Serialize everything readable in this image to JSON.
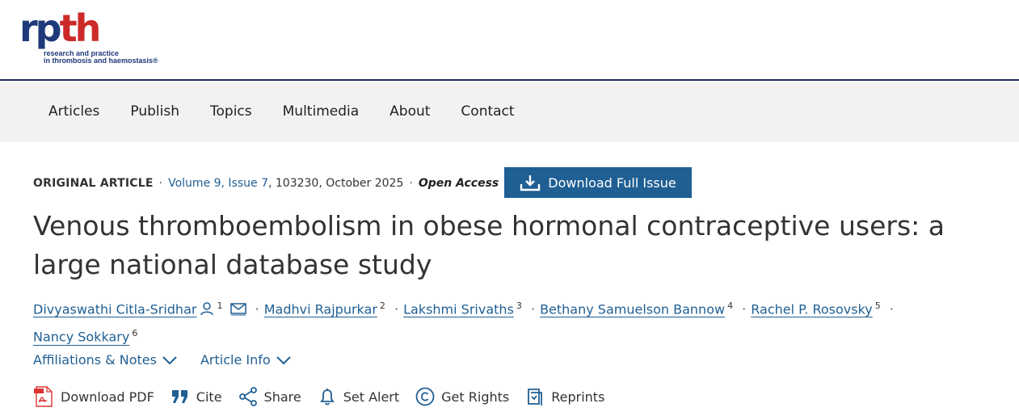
{
  "logo": {
    "mark_rp": "rp",
    "mark_th": "th",
    "tagline_1": "research and practice",
    "tagline_2": "in thrombosis and haemostasis®"
  },
  "nav": {
    "items": [
      "Articles",
      "Publish",
      "Topics",
      "Multimedia",
      "About",
      "Contact"
    ]
  },
  "meta": {
    "article_type": "ORIGINAL ARTICLE",
    "volume": "Volume 9, Issue 7",
    "details": ", 103230, October 2025",
    "access": "Open Access"
  },
  "download_issue_label": "Download Full Issue",
  "title": "Venous thromboembolism in obese hormonal contraceptive users: a large national database study",
  "authors": [
    {
      "name": "Divyaswathi Citla-Sridhar",
      "sup": "1"
    },
    {
      "name": "Madhvi Rajpurkar",
      "sup": "2"
    },
    {
      "name": "Lakshmi Srivaths",
      "sup": "3"
    },
    {
      "name": "Bethany Samuelson Bannow",
      "sup": "4"
    },
    {
      "name": "Rachel P. Rosovsky",
      "sup": "5"
    },
    {
      "name": "Nancy Sokkary",
      "sup": "6"
    }
  ],
  "toggles": {
    "affiliations": "Affiliations & Notes",
    "article_info": "Article Info"
  },
  "actions": {
    "download_pdf": "Download PDF",
    "cite": "Cite",
    "share": "Share",
    "set_alert": "Set Alert",
    "get_rights": "Get Rights",
    "reprints": "Reprints"
  },
  "colors": {
    "accent": "#1f5f94",
    "logo_blue": "#1e3a7a",
    "logo_red": "#cc2a2a",
    "nav_bg": "#f2f2f2"
  }
}
